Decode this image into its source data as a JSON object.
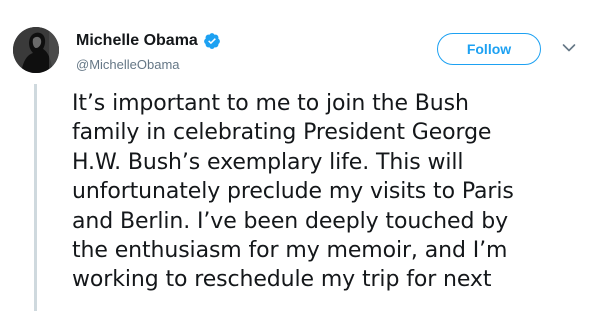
{
  "tweet": {
    "author": {
      "name": "Michelle Obama",
      "handle": "@MichelleObama",
      "verified": true
    },
    "follow_label": "Follow",
    "text_lines": [
      "It’s important to me to join the Bush",
      "family in celebrating President George",
      "H.W. Bush’s exemplary life. This will",
      "unfortunately preclude my visits to Paris",
      "and Berlin. I’ve been deeply touched by",
      "the enthusiasm for my memoir, and I’m",
      "working to reschedule my trip for next"
    ]
  },
  "colors": {
    "accent": "#1da1f2",
    "text": "#14171a",
    "secondary_text": "#657786",
    "thread_line": "#cfd9de"
  },
  "icons": {
    "verified": "verified-badge-icon",
    "caret": "chevron-down-icon"
  }
}
